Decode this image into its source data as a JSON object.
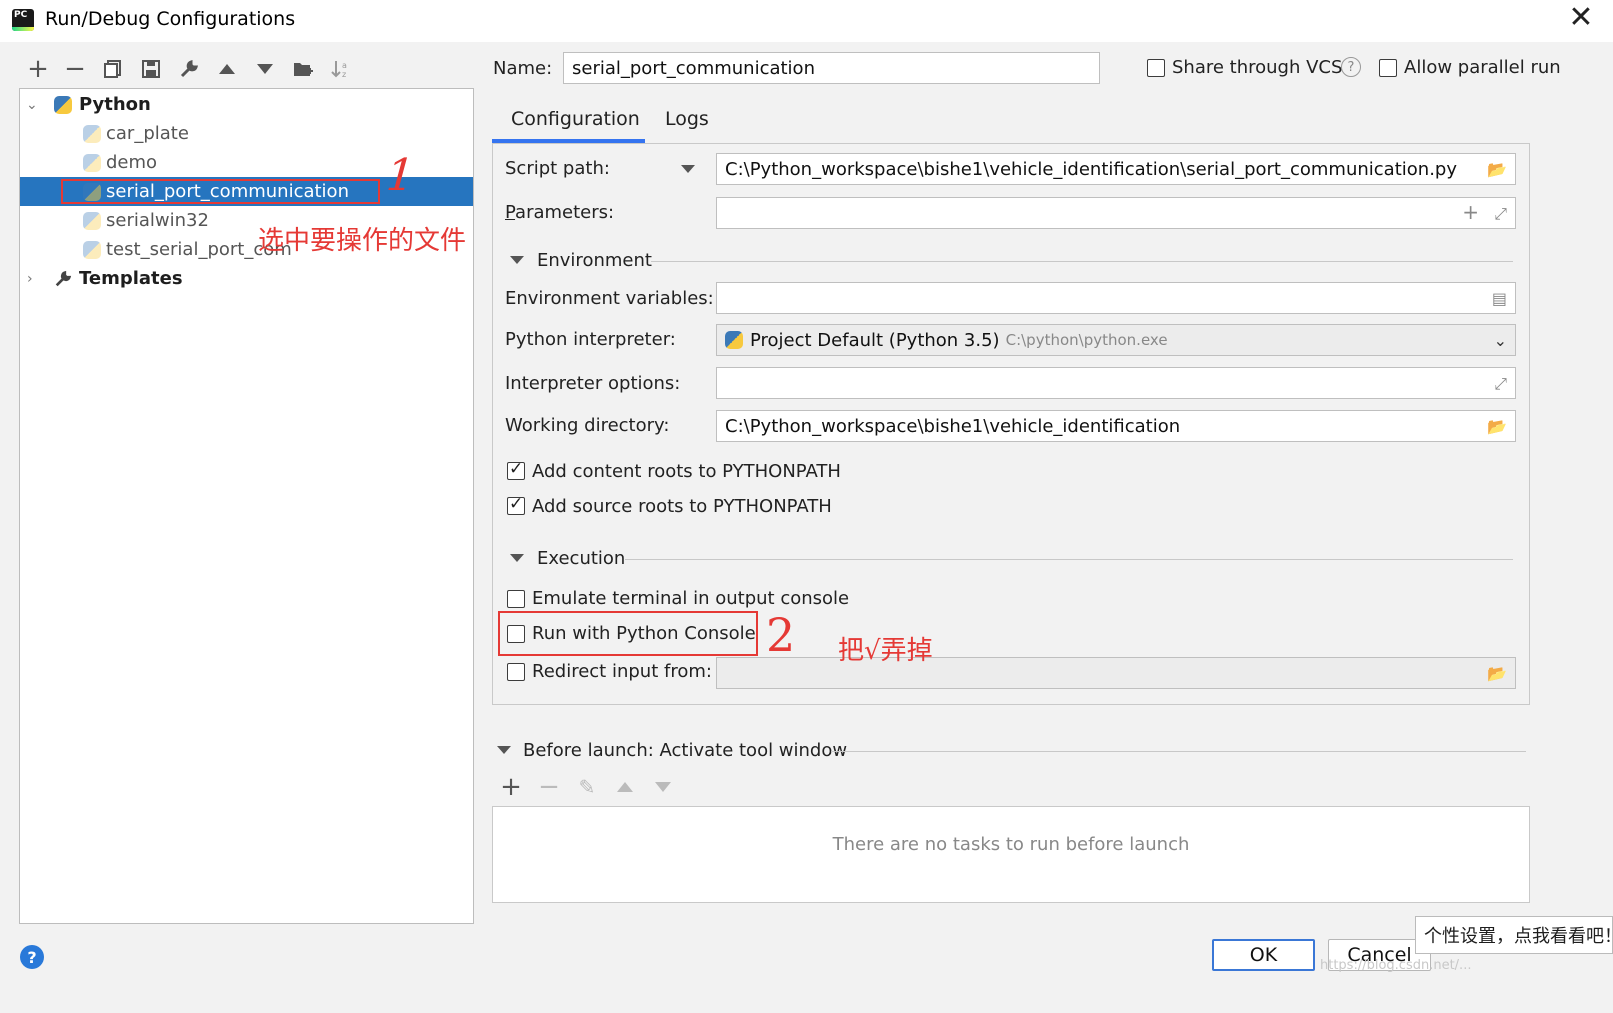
{
  "window": {
    "title": "Run/Debug Configurations"
  },
  "toolbar": {
    "icons": [
      "add-icon",
      "remove-icon",
      "copy-icon",
      "save-icon",
      "wrench-icon",
      "move-up-icon",
      "move-down-icon",
      "folder-icon",
      "sort-icon"
    ]
  },
  "tree": {
    "python_label": "Python",
    "items": [
      {
        "label": "car_plate"
      },
      {
        "label": "demo"
      },
      {
        "label": "serial_port_communication"
      },
      {
        "label": "serialwin32"
      },
      {
        "label": "test_serial_port_com"
      }
    ],
    "templates_label": "Templates"
  },
  "annotations": {
    "marker_1": "1",
    "note_1": "选中要操作的文件",
    "marker_2": "2",
    "note_2": "把√弄掉",
    "color": "#e53935"
  },
  "header": {
    "name_label": "Name:",
    "name_value": "serial_port_communication",
    "share_vcs_label": "Share through VCS",
    "share_vcs_checked": false,
    "allow_parallel_label": "Allow parallel run",
    "allow_parallel_checked": false
  },
  "tabs": [
    {
      "label": "Configuration",
      "active": true
    },
    {
      "label": "Logs",
      "active": false
    }
  ],
  "config": {
    "script_path_label": "Script path:",
    "script_path_value": "C:\\Python_workspace\\bishe1\\vehicle_identification\\serial_port_communication.py",
    "parameters_label": "Parameters:",
    "parameters_value": "",
    "environment_section": "Environment",
    "env_vars_label": "Environment variables:",
    "env_vars_value": "",
    "interpreter_label": "Python interpreter:",
    "interpreter_value": "Project Default (Python 3.5)",
    "interpreter_path": "C:\\python\\python.exe",
    "interp_options_label": "Interpreter options:",
    "interp_options_value": "",
    "working_dir_label": "Working directory:",
    "working_dir_value": "C:\\Python_workspace\\bishe1\\vehicle_identification",
    "content_roots_label": "Add content roots to PYTHONPATH",
    "content_roots_checked": true,
    "source_roots_label": "Add source roots to PYTHONPATH",
    "source_roots_checked": true,
    "execution_section": "Execution",
    "emulate_terminal_label": "Emulate terminal in output console",
    "emulate_terminal_checked": false,
    "run_console_label": "Run with Python Console",
    "run_console_checked": false,
    "redirect_label": "Redirect input from:",
    "redirect_checked": false
  },
  "before_launch": {
    "title": "Before launch: Activate tool window",
    "empty_text": "There are no tasks to run before launch"
  },
  "buttons": {
    "ok": "OK",
    "cancel": "Cancel"
  },
  "tooltip": "个性设置，点我看看吧！",
  "watermark": "https://blog.csdn.net/..."
}
